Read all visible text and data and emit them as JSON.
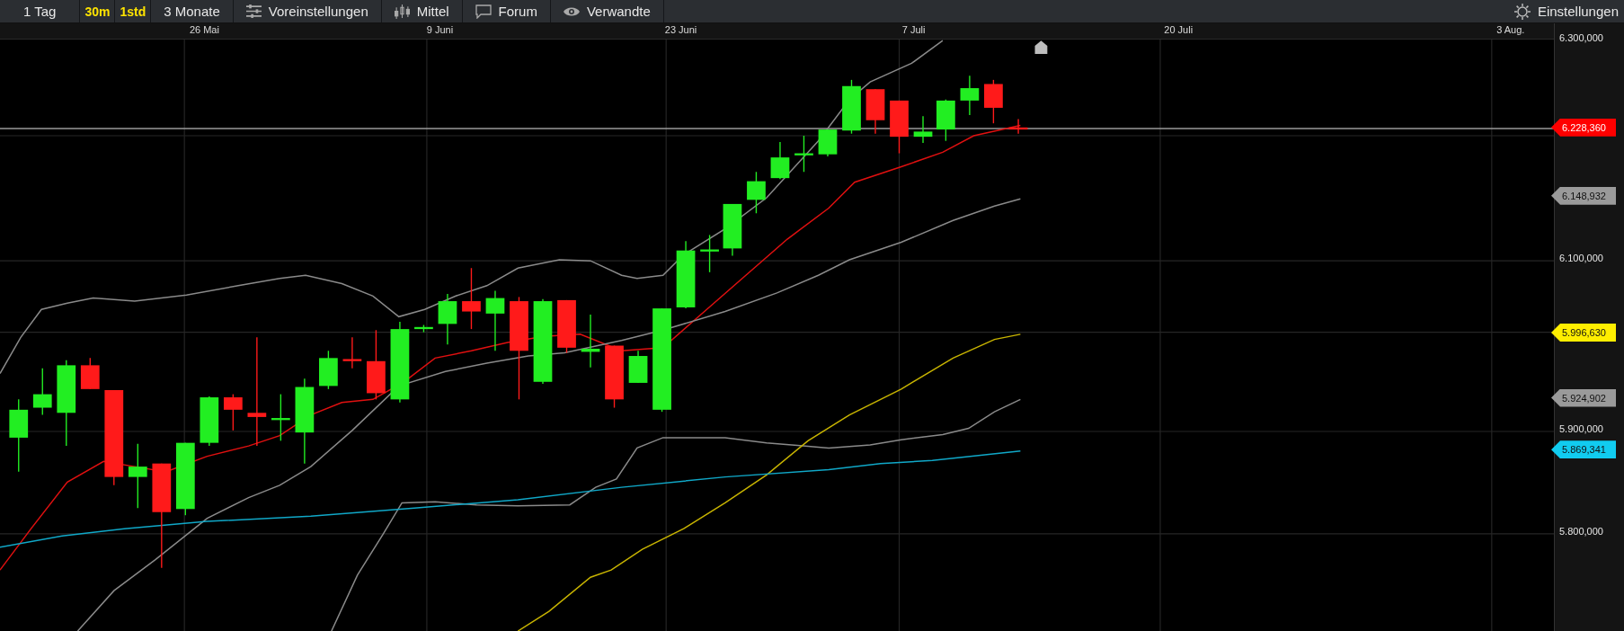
{
  "toolbar": {
    "items": [
      {
        "label": "1 Tag",
        "kind": "plain"
      },
      {
        "label": "30m",
        "kind": "interval"
      },
      {
        "label": "1std",
        "kind": "interval"
      },
      {
        "label": "3 Monate",
        "kind": "plain"
      },
      {
        "label": "Voreinstellungen",
        "kind": "presets"
      },
      {
        "label": "Mittel",
        "kind": "indicators"
      },
      {
        "label": "Forum",
        "kind": "forum"
      },
      {
        "label": "Verwandte",
        "kind": "related"
      }
    ],
    "settings": {
      "label": "Einstellungen"
    }
  },
  "date_axis": [
    "26 Mai",
    "9 Juni",
    "23 Juni",
    "7 Juli",
    "20 Juli",
    "3 Aug."
  ],
  "price_axis": [
    "6.300,000",
    "6.100,000",
    "5.900,000",
    "5.800,000"
  ],
  "price_tags": [
    {
      "text": "6.228,360",
      "color": "#ff0000"
    },
    {
      "text": "6.148,932",
      "color": "#9a9a9a"
    },
    {
      "text": "5.996,630",
      "color": "#ffee00"
    },
    {
      "text": "5.924,902",
      "color": "#9a9a9a"
    },
    {
      "text": "5.869,341",
      "color": "#11ccf0"
    }
  ]
}
